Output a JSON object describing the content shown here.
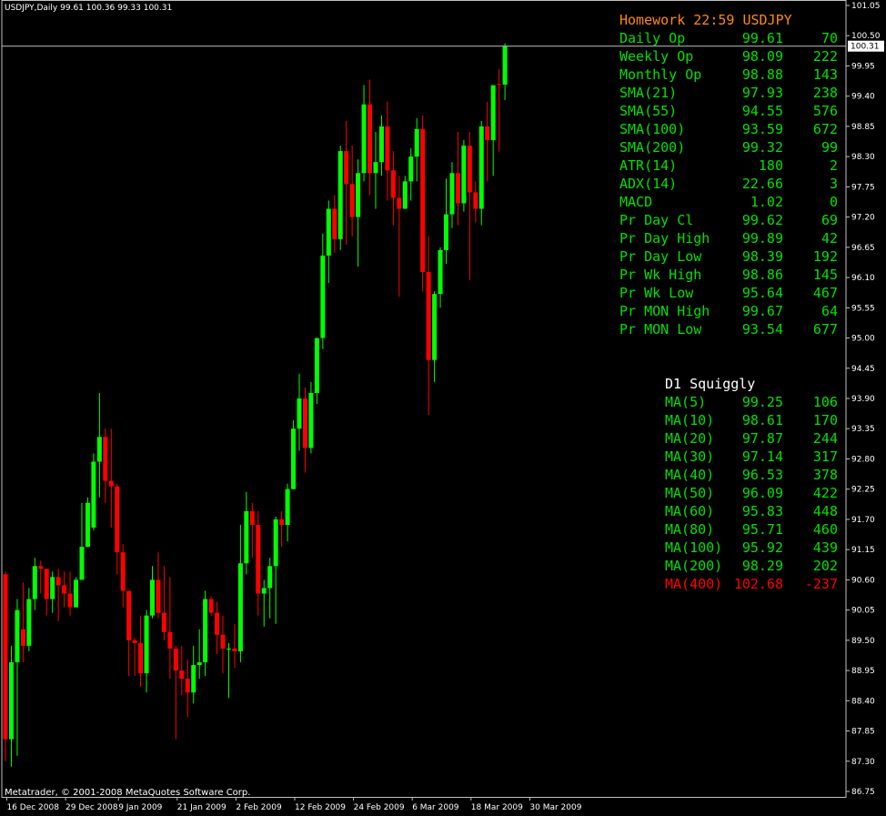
{
  "header": {
    "symbol_timeframe": "USDJPY,Daily",
    "ohlc": "99.61 100.36 99.33 100.31"
  },
  "footer_text": "Metatrader, © 2001-2008 MetaQuotes Software Corp.",
  "current_price_label": "100.31",
  "colors": {
    "background": "#000000",
    "bull": "#00ff00",
    "bear": "#ff0000",
    "panel_green": "#00e000",
    "panel_orange": "#ff8c00",
    "panel_red": "#ff0000",
    "panel_white": "#ffffff"
  },
  "panel1": {
    "title": "Homework 22:59 USDJPY",
    "rows": [
      {
        "label": "Daily Op",
        "value": "99.61",
        "pips": "70"
      },
      {
        "label": "Weekly Op",
        "value": "98.09",
        "pips": "222"
      },
      {
        "label": "Monthly Op",
        "value": "98.88",
        "pips": "143"
      },
      {
        "label": "SMA(21)",
        "value": "97.93",
        "pips": "238"
      },
      {
        "label": "SMA(55)",
        "value": "94.55",
        "pips": "576"
      },
      {
        "label": "SMA(100)",
        "value": "93.59",
        "pips": "672"
      },
      {
        "label": "SMA(200)",
        "value": "99.32",
        "pips": "99"
      },
      {
        "label": "ATR(14)",
        "value": "180",
        "pips": "2"
      },
      {
        "label": "ADX(14)",
        "value": "22.66",
        "pips": "3"
      },
      {
        "label": "MACD",
        "value": "1.02",
        "pips": "0"
      },
      {
        "label": "Pr Day Cl",
        "value": "99.62",
        "pips": "69"
      },
      {
        "label": "Pr Day High",
        "value": "99.89",
        "pips": "42"
      },
      {
        "label": "Pr Day Low",
        "value": "98.39",
        "pips": "192"
      },
      {
        "label": "Pr Wk High",
        "value": "98.86",
        "pips": "145"
      },
      {
        "label": "Pr Wk Low",
        "value": "95.64",
        "pips": "467"
      },
      {
        "label": "Pr MON High",
        "value": "99.67",
        "pips": "64"
      },
      {
        "label": "Pr MON Low",
        "value": "93.54",
        "pips": "677"
      }
    ]
  },
  "panel2": {
    "title": "D1 Squiggly",
    "rows": [
      {
        "label": "MA(5)",
        "value": "99.25",
        "pips": "106",
        "color": "green"
      },
      {
        "label": "MA(10)",
        "value": "98.61",
        "pips": "170",
        "color": "green"
      },
      {
        "label": "MA(20)",
        "value": "97.87",
        "pips": "244",
        "color": "green"
      },
      {
        "label": "MA(30)",
        "value": "97.14",
        "pips": "317",
        "color": "green"
      },
      {
        "label": "MA(40)",
        "value": "96.53",
        "pips": "378",
        "color": "green"
      },
      {
        "label": "MA(50)",
        "value": "96.09",
        "pips": "422",
        "color": "green"
      },
      {
        "label": "MA(60)",
        "value": "95.83",
        "pips": "448",
        "color": "green"
      },
      {
        "label": "MA(80)",
        "value": "95.71",
        "pips": "460",
        "color": "green"
      },
      {
        "label": "MA(100)",
        "value": "95.92",
        "pips": "439",
        "color": "green"
      },
      {
        "label": "MA(200)",
        "value": "98.29",
        "pips": "202",
        "color": "green"
      },
      {
        "label": "MA(400)",
        "value": "102.68",
        "pips": "-237",
        "color": "red"
      }
    ]
  },
  "chart_data": {
    "type": "candlestick",
    "symbol": "USDJPY",
    "timeframe": "Daily",
    "ylim": [
      86.75,
      101.05
    ],
    "y_ticks": [
      "101.05",
      "100.50",
      "99.95",
      "99.40",
      "98.85",
      "98.30",
      "97.75",
      "97.20",
      "96.65",
      "96.10",
      "95.55",
      "95.00",
      "94.45",
      "93.90",
      "93.35",
      "92.80",
      "92.25",
      "91.70",
      "91.15",
      "90.60",
      "90.05",
      "89.50",
      "88.95",
      "88.40",
      "87.85",
      "87.30",
      "86.75"
    ],
    "x_labels": [
      "16 Dec 2008",
      "29 Dec 2008",
      "9 Jan 2009",
      "21 Jan 2009",
      "2 Feb 2009",
      "12 Feb 2009",
      "24 Feb 2009",
      "6 Mar 2009",
      "18 Mar 2009",
      "30 Mar 2009"
    ],
    "x_label_index": [
      1,
      11,
      20,
      30,
      40,
      50,
      60,
      70,
      80,
      90
    ],
    "candles": [
      {
        "o": 90.7,
        "h": 90.75,
        "c": 87.7,
        "l": 87.3
      },
      {
        "o": 87.7,
        "h": 89.4,
        "c": 89.1,
        "l": 87.2
      },
      {
        "o": 89.1,
        "h": 90.25,
        "c": 90.05,
        "l": 87.4
      },
      {
        "o": 89.7,
        "h": 90.55,
        "c": 89.4,
        "l": 89.1
      },
      {
        "o": 89.4,
        "h": 90.45,
        "c": 90.25,
        "l": 89.3
      },
      {
        "o": 90.25,
        "h": 91.0,
        "c": 90.85,
        "l": 90.05
      },
      {
        "o": 90.85,
        "h": 90.95,
        "c": 90.8,
        "l": 90.35
      },
      {
        "o": 90.8,
        "h": 90.8,
        "c": 90.25,
        "l": 89.95
      },
      {
        "o": 90.25,
        "h": 90.75,
        "c": 90.65,
        "l": 90.0
      },
      {
        "o": 90.65,
        "h": 90.8,
        "c": 90.5,
        "l": 89.85
      },
      {
        "o": 90.5,
        "h": 90.75,
        "c": 90.35,
        "l": 90.1
      },
      {
        "o": 90.35,
        "h": 90.75,
        "c": 90.1,
        "l": 89.95
      },
      {
        "o": 90.1,
        "h": 90.65,
        "c": 90.6,
        "l": 90.1
      },
      {
        "o": 90.6,
        "h": 92.0,
        "c": 91.2,
        "l": 90.6
      },
      {
        "o": 91.2,
        "h": 92.1,
        "c": 92.0,
        "l": 91.2
      },
      {
        "o": 91.55,
        "h": 92.9,
        "c": 92.75,
        "l": 91.5
      },
      {
        "o": 92.75,
        "h": 94.0,
        "c": 93.2,
        "l": 92.1
      },
      {
        "o": 93.2,
        "h": 93.35,
        "c": 92.4,
        "l": 92.0
      },
      {
        "o": 92.4,
        "h": 93.35,
        "c": 92.3,
        "l": 91.55
      },
      {
        "o": 92.3,
        "h": 92.35,
        "c": 91.1,
        "l": 90.7
      },
      {
        "o": 91.1,
        "h": 91.25,
        "c": 90.4,
        "l": 90.1
      },
      {
        "o": 90.4,
        "h": 90.4,
        "c": 89.5,
        "l": 88.85
      },
      {
        "o": 89.5,
        "h": 89.55,
        "c": 89.45,
        "l": 88.85
      },
      {
        "o": 89.45,
        "h": 89.95,
        "c": 88.9,
        "l": 88.65
      },
      {
        "o": 88.9,
        "h": 90.05,
        "c": 89.95,
        "l": 88.55
      },
      {
        "o": 89.95,
        "h": 90.85,
        "c": 90.6,
        "l": 89.9
      },
      {
        "o": 90.6,
        "h": 91.1,
        "c": 90.0,
        "l": 89.9
      },
      {
        "o": 90.0,
        "h": 90.85,
        "c": 89.65,
        "l": 89.5
      },
      {
        "o": 89.65,
        "h": 90.65,
        "c": 89.35,
        "l": 88.8
      },
      {
        "o": 89.35,
        "h": 89.4,
        "c": 88.95,
        "l": 87.7
      },
      {
        "o": 88.95,
        "h": 89.4,
        "c": 88.8,
        "l": 88.5
      },
      {
        "o": 88.8,
        "h": 89.15,
        "c": 88.55,
        "l": 88.1
      },
      {
        "o": 88.55,
        "h": 89.4,
        "c": 89.05,
        "l": 88.35
      },
      {
        "o": 89.05,
        "h": 89.7,
        "c": 89.1,
        "l": 88.8
      },
      {
        "o": 89.1,
        "h": 90.4,
        "c": 90.25,
        "l": 88.85
      },
      {
        "o": 90.25,
        "h": 90.3,
        "c": 90.0,
        "l": 89.95
      },
      {
        "o": 90.0,
        "h": 90.2,
        "c": 89.6,
        "l": 89.25
      },
      {
        "o": 89.6,
        "h": 89.95,
        "c": 89.35,
        "l": 88.9
      },
      {
        "o": 89.35,
        "h": 89.45,
        "c": 89.35,
        "l": 88.45
      },
      {
        "o": 89.35,
        "h": 89.8,
        "c": 89.3,
        "l": 89.0
      },
      {
        "o": 89.3,
        "h": 91.6,
        "c": 90.9,
        "l": 89.1
      },
      {
        "o": 90.9,
        "h": 92.2,
        "c": 91.85,
        "l": 90.7
      },
      {
        "o": 91.85,
        "h": 92.0,
        "c": 91.6,
        "l": 91.0
      },
      {
        "o": 91.6,
        "h": 91.85,
        "c": 90.35,
        "l": 89.95
      },
      {
        "o": 90.35,
        "h": 90.6,
        "c": 90.45,
        "l": 89.75
      },
      {
        "o": 90.45,
        "h": 91.0,
        "c": 90.85,
        "l": 89.9
      },
      {
        "o": 90.85,
        "h": 91.75,
        "c": 91.7,
        "l": 89.8
      },
      {
        "o": 91.7,
        "h": 91.85,
        "c": 91.6,
        "l": 91.2
      },
      {
        "o": 91.6,
        "h": 92.35,
        "c": 92.25,
        "l": 91.3
      },
      {
        "o": 92.25,
        "h": 93.5,
        "c": 93.35,
        "l": 92.25
      },
      {
        "o": 93.35,
        "h": 94.35,
        "c": 93.9,
        "l": 92.95
      },
      {
        "o": 93.9,
        "h": 94.1,
        "c": 93.0,
        "l": 92.55
      },
      {
        "o": 93.0,
        "h": 94.2,
        "c": 94.0,
        "l": 92.9
      },
      {
        "o": 94.0,
        "h": 94.9,
        "c": 95.0,
        "l": 93.8
      },
      {
        "o": 95.0,
        "h": 96.9,
        "c": 96.5,
        "l": 94.8
      },
      {
        "o": 96.5,
        "h": 97.5,
        "c": 97.35,
        "l": 96.0
      },
      {
        "o": 97.35,
        "h": 97.6,
        "c": 96.8,
        "l": 96.55
      },
      {
        "o": 96.8,
        "h": 98.5,
        "c": 98.4,
        "l": 96.6
      },
      {
        "o": 98.4,
        "h": 98.95,
        "c": 97.8,
        "l": 96.7
      },
      {
        "o": 97.8,
        "h": 98.5,
        "c": 97.2,
        "l": 96.85
      },
      {
        "o": 97.2,
        "h": 98.25,
        "c": 98.0,
        "l": 96.3
      },
      {
        "o": 98.0,
        "h": 99.6,
        "c": 99.25,
        "l": 97.85
      },
      {
        "o": 99.25,
        "h": 99.7,
        "c": 98.0,
        "l": 97.6
      },
      {
        "o": 98.0,
        "h": 98.75,
        "c": 98.2,
        "l": 97.35
      },
      {
        "o": 98.2,
        "h": 99.05,
        "c": 98.85,
        "l": 97.95
      },
      {
        "o": 98.85,
        "h": 99.3,
        "c": 98.05,
        "l": 97.5
      },
      {
        "o": 98.05,
        "h": 98.4,
        "c": 97.55,
        "l": 97.05
      },
      {
        "o": 97.55,
        "h": 97.95,
        "c": 97.35,
        "l": 95.75
      },
      {
        "o": 97.35,
        "h": 97.95,
        "c": 97.85,
        "l": 97.35
      },
      {
        "o": 97.85,
        "h": 98.45,
        "c": 98.3,
        "l": 97.5
      },
      {
        "o": 98.3,
        "h": 99.0,
        "c": 98.8,
        "l": 97.85
      },
      {
        "o": 98.8,
        "h": 99.05,
        "c": 96.2,
        "l": 95.85
      },
      {
        "o": 96.2,
        "h": 96.85,
        "c": 94.6,
        "l": 93.6
      },
      {
        "o": 94.6,
        "h": 95.85,
        "c": 95.8,
        "l": 94.2
      },
      {
        "o": 95.8,
        "h": 96.65,
        "c": 96.6,
        "l": 95.55
      },
      {
        "o": 96.6,
        "h": 97.9,
        "c": 97.25,
        "l": 96.35
      },
      {
        "o": 97.25,
        "h": 98.2,
        "c": 98.0,
        "l": 97.0
      },
      {
        "o": 98.0,
        "h": 98.75,
        "c": 97.45,
        "l": 97.05
      },
      {
        "o": 97.45,
        "h": 98.6,
        "c": 98.5,
        "l": 97.3
      },
      {
        "o": 98.5,
        "h": 98.75,
        "c": 97.65,
        "l": 96.05
      },
      {
        "o": 97.65,
        "h": 97.85,
        "c": 97.35,
        "l": 97.1
      },
      {
        "o": 97.35,
        "h": 98.95,
        "c": 98.85,
        "l": 97.05
      },
      {
        "o": 98.85,
        "h": 99.3,
        "c": 98.6,
        "l": 97.85
      },
      {
        "o": 98.6,
        "h": 99.5,
        "c": 99.6,
        "l": 97.95
      },
      {
        "o": 99.62,
        "h": 99.89,
        "c": 99.61,
        "l": 98.39
      },
      {
        "o": 99.61,
        "h": 100.36,
        "c": 100.31,
        "l": 99.33
      }
    ]
  }
}
